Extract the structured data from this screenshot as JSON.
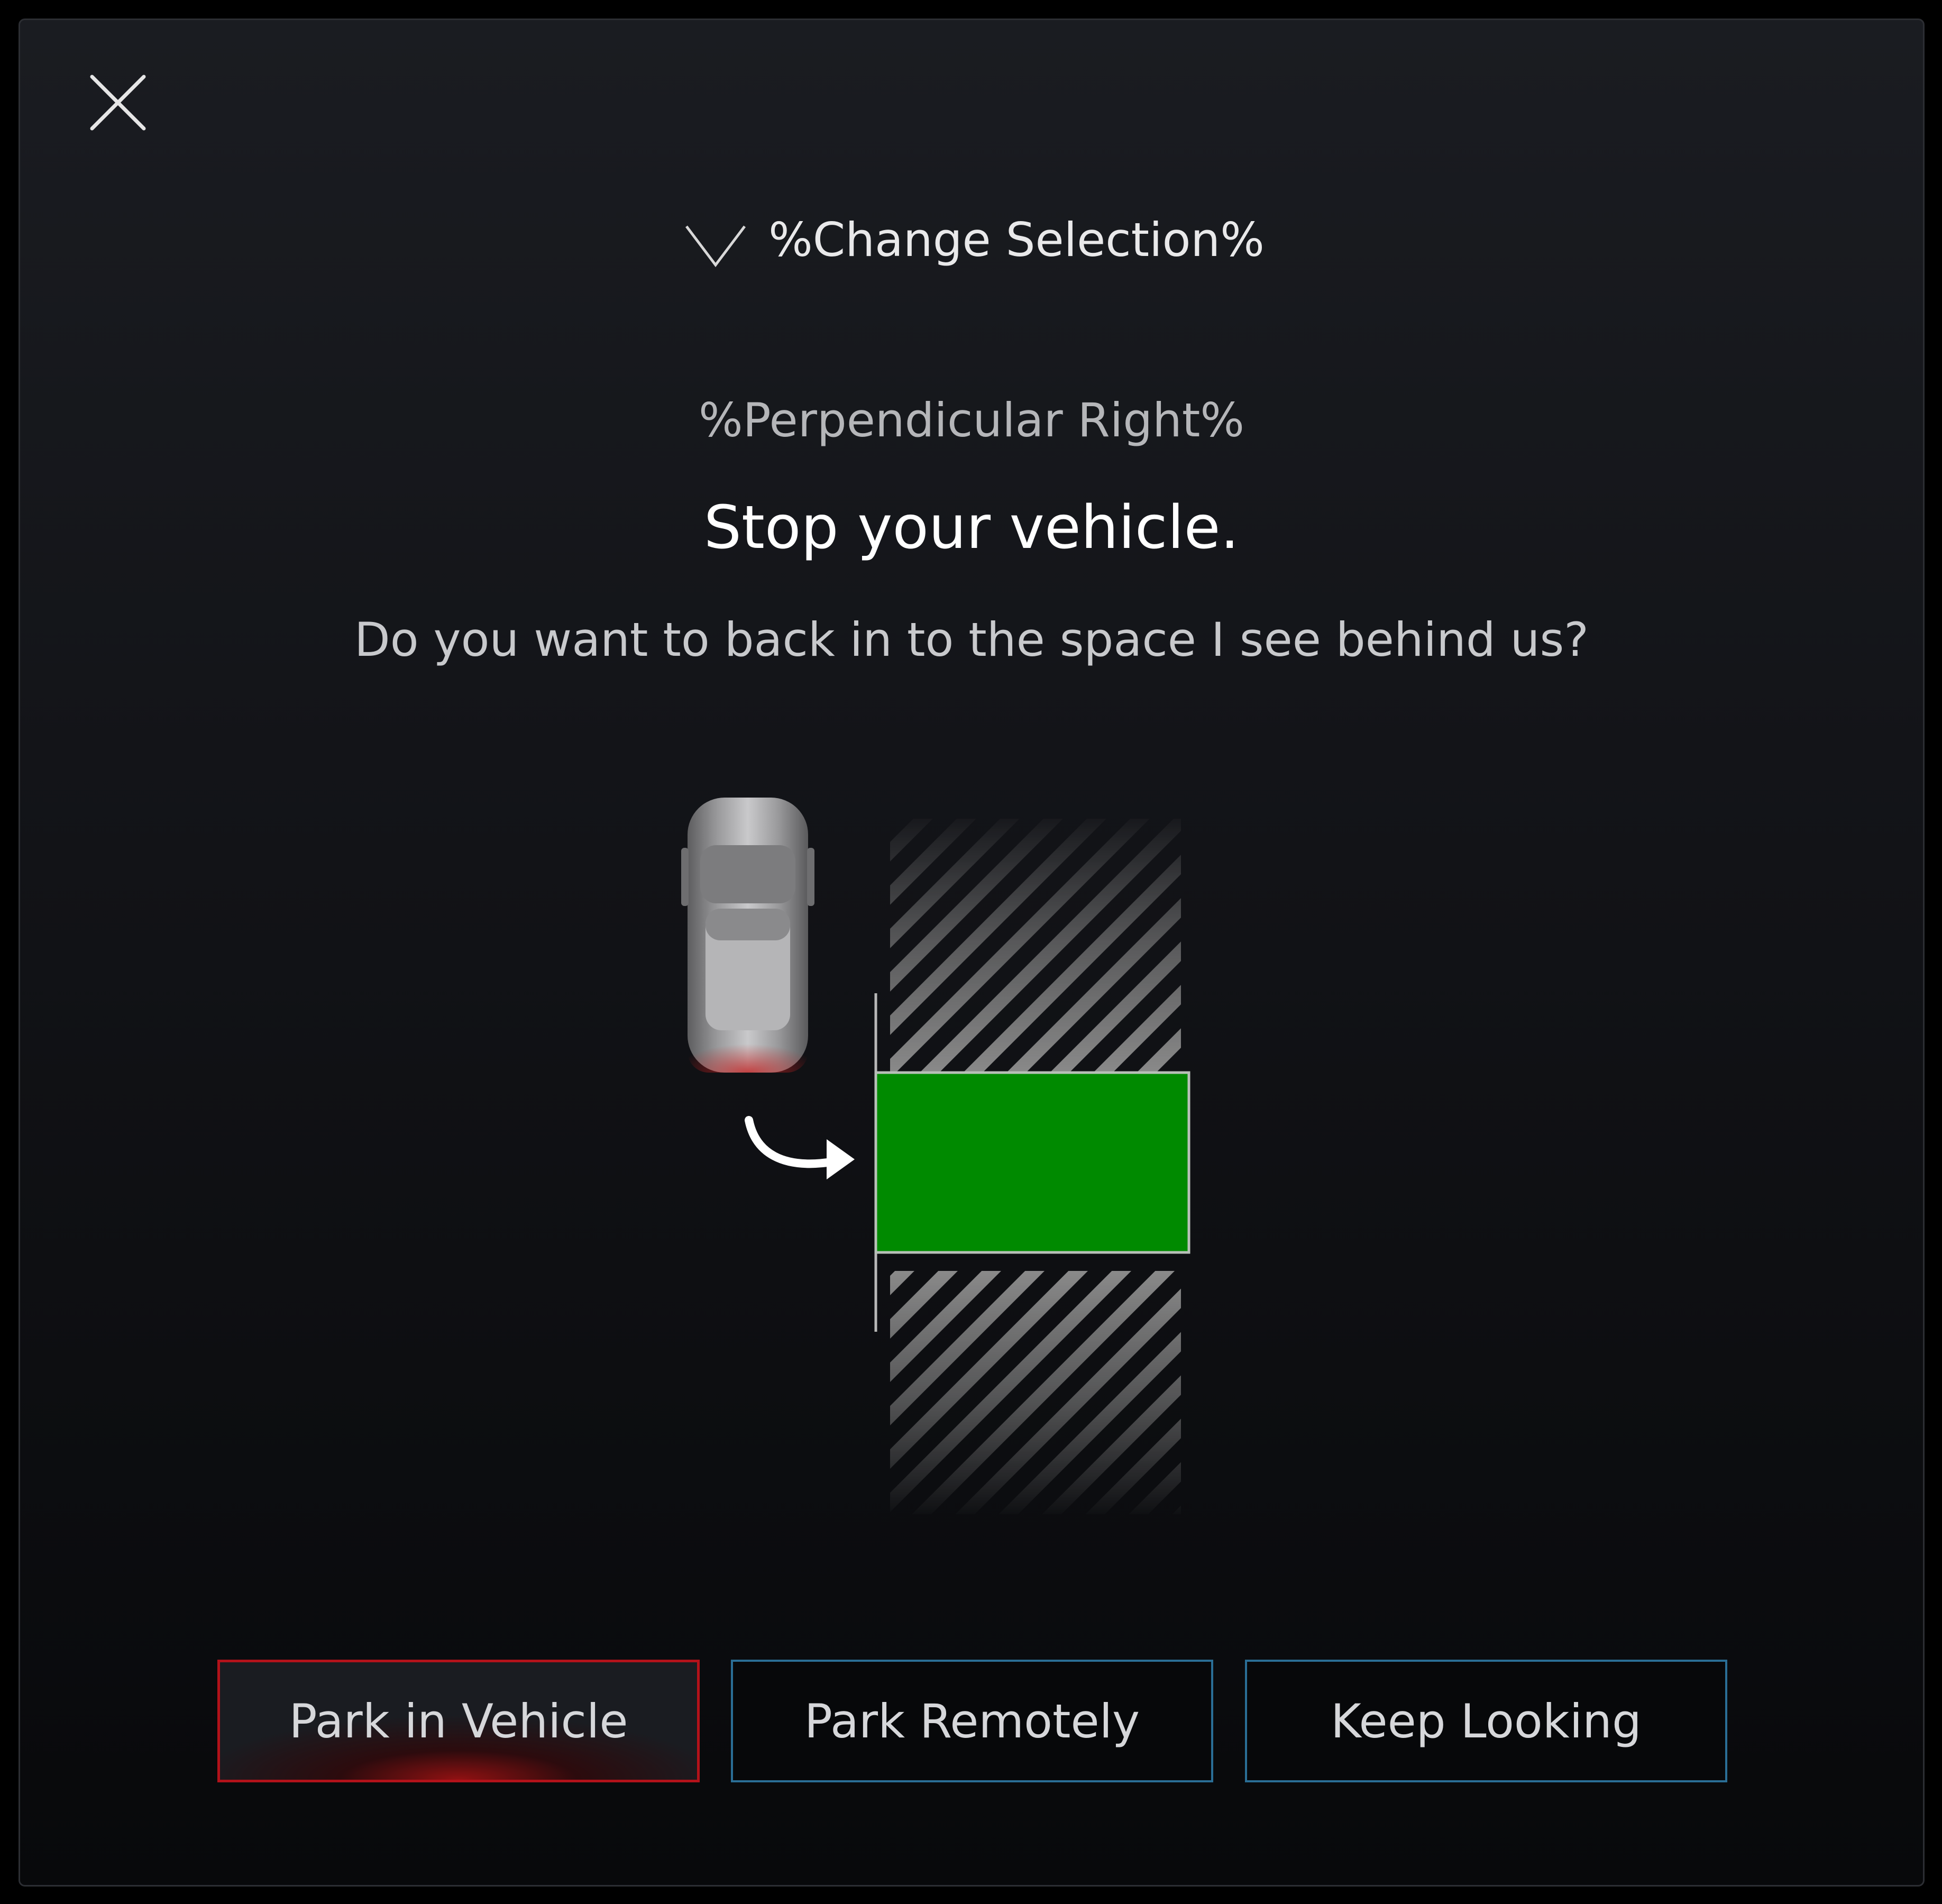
{
  "header": {
    "change_selection_label": "%Change Selection%"
  },
  "content": {
    "subtitle": "%Perpendicular Right%",
    "headline": "Stop your vehicle.",
    "question": "Do you want to back in to the space I see behind us?"
  },
  "illustration": {
    "target_space_color": "#008a00"
  },
  "buttons": {
    "park_in_vehicle": "Park in Vehicle",
    "park_remotely": "Park Remotely",
    "keep_looking": "Keep Looking"
  },
  "colors": {
    "selected_button_border": "#b3121a",
    "button_border": "#2a6e96"
  },
  "icons": {
    "close": "close-icon",
    "chevron": "chevron-down-icon",
    "arrow": "curved-arrow-icon",
    "car": "car-icon"
  }
}
